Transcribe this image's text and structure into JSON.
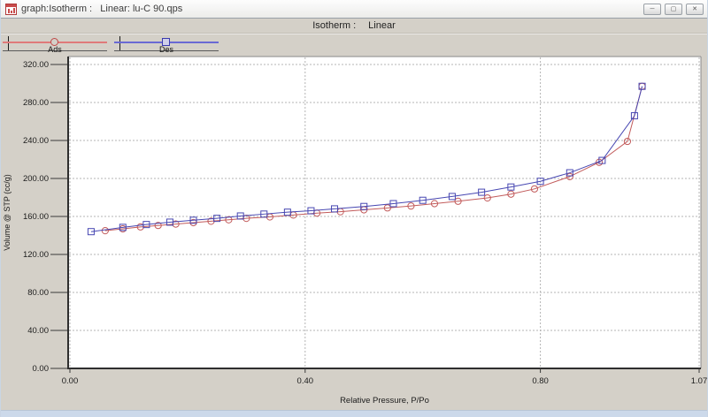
{
  "window": {
    "title": "graph:Isotherm :   Linear: lu-C 90.qps",
    "minimize_glyph": "─",
    "restore_glyph": "▢",
    "close_glyph": "✕"
  },
  "toolbar": {
    "label": "Isotherm :",
    "value": "Linear"
  },
  "legend": [
    {
      "label": "Ads",
      "color": "#c25b5b",
      "marker": "circle"
    },
    {
      "label": "Des",
      "color": "#4747b2",
      "marker": "square"
    }
  ],
  "chart_data": {
    "type": "line",
    "title": "",
    "xlabel": "Relative Pressure, P/Po",
    "ylabel": "Volume @ STP (cc/g)",
    "xlim": [
      0,
      1.07
    ],
    "ylim": [
      0,
      320
    ],
    "x_ticks": [
      0,
      0.4,
      0.8,
      1.07
    ],
    "x_tick_labels": [
      "0.00",
      "0.40",
      "0.80",
      "1.07"
    ],
    "y_ticks": [
      320,
      280,
      240,
      200,
      160,
      120,
      80,
      40,
      0
    ],
    "y_tick_labels": [
      "320.00",
      "280.00",
      "240.00",
      "200.00",
      "160.00",
      "120.00",
      "80.00",
      "40.00",
      "0.00"
    ],
    "grid": "dashed",
    "legend_position": "top-left-toolbar",
    "series": [
      {
        "name": "Ads",
        "marker": "circle",
        "color": "#c25b5b",
        "x": [
          0.06,
          0.09,
          0.12,
          0.15,
          0.18,
          0.21,
          0.24,
          0.27,
          0.3,
          0.34,
          0.38,
          0.42,
          0.46,
          0.5,
          0.54,
          0.58,
          0.62,
          0.66,
          0.71,
          0.75,
          0.79,
          0.85,
          0.9,
          0.948,
          0.973
        ],
        "y": [
          145,
          147,
          149,
          150.5,
          152,
          153.5,
          155,
          156.5,
          158,
          159.5,
          161.5,
          163.5,
          165,
          167,
          169,
          171,
          173.5,
          176,
          179.5,
          183.5,
          189,
          202,
          217,
          239,
          297
        ]
      },
      {
        "name": "Des",
        "marker": "square",
        "color": "#4747b2",
        "x": [
          0.973,
          0.96,
          0.905,
          0.85,
          0.8,
          0.75,
          0.7,
          0.65,
          0.6,
          0.55,
          0.5,
          0.45,
          0.41,
          0.37,
          0.33,
          0.29,
          0.25,
          0.21,
          0.17,
          0.13,
          0.09,
          0.036
        ],
        "y": [
          297,
          266,
          219,
          206,
          197,
          191,
          185.5,
          181,
          177,
          173.5,
          170.5,
          168,
          166,
          164.5,
          162.5,
          160.5,
          158,
          156,
          154,
          151.5,
          148.5,
          144
        ]
      }
    ]
  }
}
